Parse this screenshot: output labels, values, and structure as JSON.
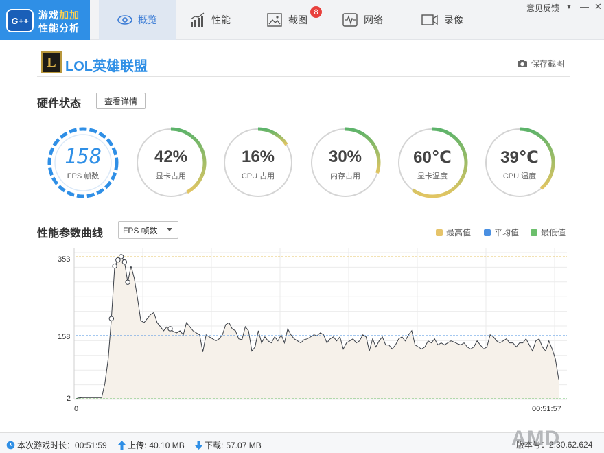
{
  "brand": {
    "logo": "G++",
    "line1_a": "游戏",
    "line1_b": "加加",
    "line2": "性能分析"
  },
  "tabs": [
    {
      "label": "概览",
      "icon": "eye-icon",
      "active": true
    },
    {
      "label": "性能",
      "icon": "bar-chart-icon"
    },
    {
      "label": "截图",
      "icon": "image-icon",
      "badge": "8"
    },
    {
      "label": "网络",
      "icon": "pulse-icon"
    },
    {
      "label": "录像",
      "icon": "video-camera-icon"
    }
  ],
  "window": {
    "feedback": "意见反馈",
    "menu": "▼",
    "minimize": "—",
    "close": "✕"
  },
  "game": {
    "icon_letter": "L",
    "title": "LOL英雄联盟",
    "save_screenshot": "保存截图"
  },
  "hardware": {
    "title": "硬件状态",
    "detail_button": "查看详情",
    "gauges": [
      {
        "value": "158",
        "label": "FPS 帧数",
        "fraction": 1.0
      },
      {
        "value": "42%",
        "label": "显卡占用",
        "fraction": 0.42
      },
      {
        "value": "16%",
        "label": "CPU 占用",
        "fraction": 0.16
      },
      {
        "value": "30%",
        "label": "内存占用",
        "fraction": 0.3
      },
      {
        "value": "60℃",
        "label": "显卡温度",
        "fraction": 0.6
      },
      {
        "value": "39℃",
        "label": "CPU 温度",
        "fraction": 0.39
      }
    ]
  },
  "curve": {
    "title": "性能参数曲线",
    "select_value": "FPS 帧数",
    "legend": [
      {
        "label": "最高值",
        "color": "#e6c46a"
      },
      {
        "label": "平均值",
        "color": "#4a90e2"
      },
      {
        "label": "最低值",
        "color": "#6cbf6c"
      }
    ]
  },
  "chart_data": {
    "type": "area",
    "series": [
      {
        "values": [
          2,
          4,
          5,
          5,
          5,
          5,
          5,
          5,
          5,
          40,
          100,
          200,
          330,
          345,
          353,
          340,
          290,
          330,
          300,
          250,
          195,
          190,
          200,
          210,
          215,
          190,
          180,
          170,
          180,
          175,
          168,
          165,
          170,
          160,
          190,
          180,
          170,
          165,
          160,
          118,
          160,
          155,
          150,
          145,
          150,
          160,
          185,
          190,
          175,
          170,
          150,
          148,
          180,
          170,
          120,
          130,
          170,
          140,
          155,
          145,
          140,
          155,
          145,
          160,
          140,
          175,
          160,
          150,
          145,
          140,
          148,
          150,
          155,
          160,
          158,
          165,
          160,
          140,
          150,
          155,
          145,
          155,
          125,
          140,
          145,
          150,
          140,
          145,
          160,
          155,
          120,
          150,
          130,
          145,
          155,
          135,
          135,
          125,
          135,
          150,
          155,
          145,
          160,
          170,
          135,
          130,
          125,
          130,
          145,
          140,
          150,
          135,
          140,
          135,
          140,
          145,
          142,
          138,
          135,
          140,
          130,
          125,
          130,
          145,
          135,
          125,
          130,
          160,
          155,
          145,
          140,
          145,
          150,
          140,
          140,
          130,
          140,
          140,
          150,
          135,
          120,
          145,
          150,
          130,
          120,
          145,
          125,
          100,
          50
        ]
      }
    ],
    "x_start_label": "0",
    "x_end_label": "00:51:57",
    "yticks": [
      "353",
      "158",
      "2"
    ],
    "ylim": [
      2,
      353
    ],
    "max": 353,
    "avg": 158,
    "min": 2
  },
  "status": {
    "duration_label": "本次游戏时长：",
    "duration": "00:51:59",
    "upload_label": "上传:",
    "upload": "40.10 MB",
    "download_label": "下载:",
    "download": "57.07 MB",
    "amd": "AMD",
    "version_label": "版本号：",
    "version": "2.30.62.624"
  }
}
